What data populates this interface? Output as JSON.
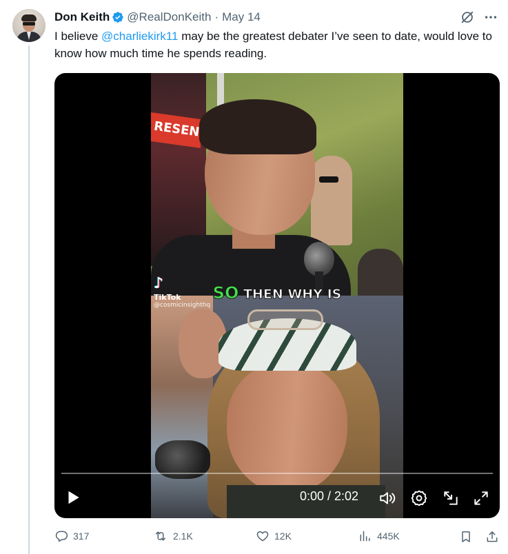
{
  "tweet": {
    "author": {
      "name": "Don Keith",
      "handle": "@RealDonKeith",
      "verified": true,
      "verified_color": "#1d9bf0"
    },
    "separator": "·",
    "date": "May 14",
    "text_before": "I believe ",
    "mention": "@charliekirk11",
    "text_after": " may be the greatest debater I’ve seen to date, would love to know how much time he spends reading.",
    "header_icons": [
      "grok-icon",
      "more-icon"
    ]
  },
  "video": {
    "overlay": {
      "caption_highlight": "SO",
      "caption_rest": " THEN WHY IS",
      "tiktok_brand": "TikTok",
      "tiktok_user": "@cosmicinsighthq",
      "banner_text": "RESENT"
    },
    "player": {
      "time": "0:00 / 2:02",
      "progress": 0,
      "controls": [
        "play-icon",
        "volume-icon",
        "settings-icon",
        "pip-icon",
        "fullscreen-icon"
      ]
    }
  },
  "actions": {
    "replies": "317",
    "reposts": "2.1K",
    "likes": "12K",
    "views": "445K",
    "extra": [
      "bookmark-icon",
      "share-icon"
    ]
  },
  "colors": {
    "text": "#0f1419",
    "secondary": "#536471",
    "accent": "#1d9bf0",
    "caption_green": "#43e24b"
  }
}
